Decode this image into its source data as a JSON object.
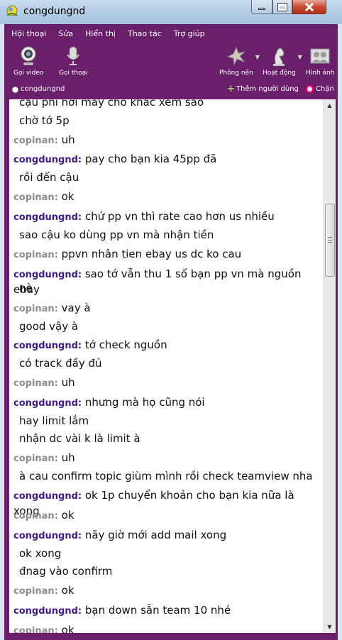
{
  "window": {
    "title": "congdungnd"
  },
  "menu": [
    "Hội thoại",
    "Sửa",
    "Hiển thị",
    "Thao tác",
    "Trợ giúp"
  ],
  "toolbar": {
    "video_call": "Gọi video",
    "voice_call": "Gọi thoại",
    "background": "Phông nền",
    "activities": "Hoạt động",
    "avatar": "Hình ảnh"
  },
  "status": {
    "name": "congdungnd",
    "add_user": "Thêm người dùng",
    "block": "Chặn"
  },
  "messages": [
    {
      "sender": "",
      "text": "cậu phi hơi mấy cho khác xem sao"
    },
    {
      "sender": "",
      "text": "chờ tớ 5p"
    },
    {
      "sender": "copinan:",
      "text": "uh"
    },
    {
      "sender": "congdungnd:",
      "text": "pay cho bạn kia 45pp đã"
    },
    {
      "sender": "",
      "text": "rồi đến cậu"
    },
    {
      "sender": "copinan:",
      "text": "ok"
    },
    {
      "sender": "congdungnd:",
      "text": "chứ pp vn thì rate cao hơn us nhiều"
    },
    {
      "sender": "",
      "text": "sao cậu ko dùng pp vn mà nhận tiền"
    },
    {
      "sender": "copinan:",
      "text": "ppvn nhân tien ebay us dc ko cau"
    },
    {
      "sender": "congdungnd:",
      "text": "sao tớ vẫn thu 1 số bạn pp vn mà nguồn ebay"
    },
    {
      "sender": "",
      "text": "nè"
    },
    {
      "sender": "copinan:",
      "text": "vay à"
    },
    {
      "sender": "",
      "text": "good vậy à"
    },
    {
      "sender": "congdungnd:",
      "text": "tớ check nguồn"
    },
    {
      "sender": "",
      "text": "có track đầy đủ"
    },
    {
      "sender": "copinan:",
      "text": "uh"
    },
    {
      "sender": "congdungnd:",
      "text": "nhưng mà họ cũng nói"
    },
    {
      "sender": "",
      "text": "hay limit lắm"
    },
    {
      "sender": "",
      "text": "nhận dc vài k là limit à"
    },
    {
      "sender": "copinan:",
      "text": "uh"
    },
    {
      "sender": "",
      "text": "à cau confirm topic giùm mình rồi check teamview nha"
    },
    {
      "sender": "congdungnd:",
      "text": "ok 1p chuyển khoản cho bạn kia nữa là xong"
    },
    {
      "sender": "copinan:",
      "text": "ok"
    },
    {
      "sender": "congdungnd:",
      "text": "nãy giờ mới add mail xong"
    },
    {
      "sender": "",
      "text": "ok xong"
    },
    {
      "sender": "",
      "text": "đnag vào confirm"
    },
    {
      "sender": "copinan:",
      "text": "ok"
    },
    {
      "sender": "congdungnd:",
      "text": "bạn down sẵn team 10 nhé"
    },
    {
      "sender": "copinan:",
      "text": "ok"
    }
  ],
  "colors": {
    "frame": "#6a1f6a",
    "me_sender": "#3e1b8c",
    "other_sender": "#8c8c8c"
  }
}
